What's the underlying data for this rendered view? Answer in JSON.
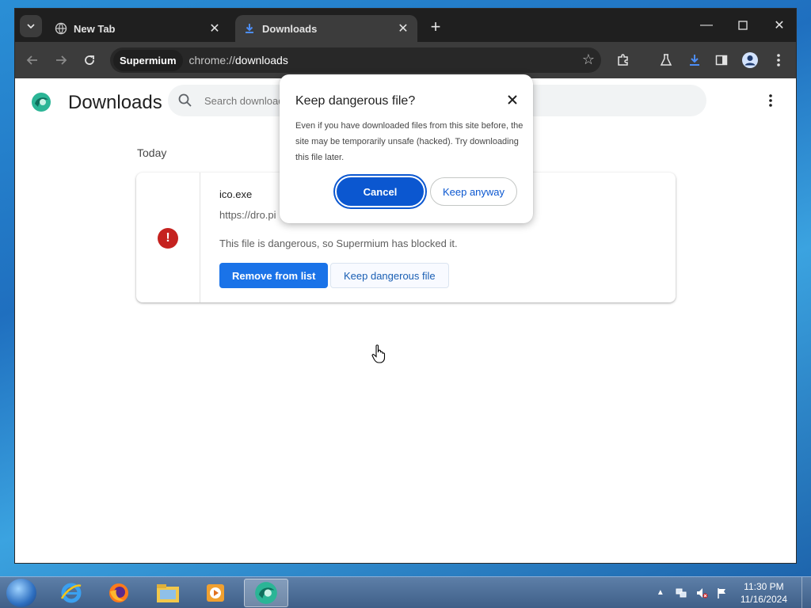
{
  "browser": {
    "tabs": [
      {
        "title": "New Tab",
        "active": false
      },
      {
        "title": "Downloads",
        "active": true
      }
    ],
    "omnibox": {
      "chip": "Supermium",
      "url_scheme": "chrome://",
      "url_path": "downloads"
    }
  },
  "page": {
    "title": "Downloads",
    "search_placeholder": "Search downloads",
    "section_date": "Today",
    "download": {
      "filename": "ico.exe",
      "url": "https://dro.pi",
      "message": "This file is dangerous, so Supermium has blocked it.",
      "remove_label": "Remove from list",
      "keep_label": "Keep dangerous file"
    }
  },
  "dialog": {
    "title": "Keep dangerous file?",
    "body": "Even if you have downloaded files from this site before, the site may be temporarily unsafe (hacked). Try downloading this file later.",
    "cancel_label": "Cancel",
    "keep_label": "Keep anyway"
  },
  "taskbar": {
    "time": "11:30 PM",
    "date": "11/16/2024"
  },
  "colors": {
    "accent": "#1a73e8",
    "danger": "#c5221f",
    "dialog_primary": "#0b57d0"
  }
}
